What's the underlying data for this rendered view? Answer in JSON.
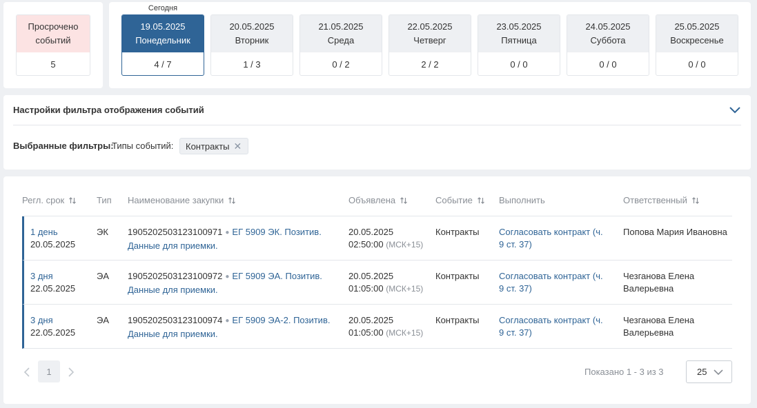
{
  "calendar": {
    "overdue": {
      "line1": "Просрочено",
      "line2": "событий",
      "count": "5"
    },
    "today_label": "Сегодня",
    "days": [
      {
        "date": "19.05.2025",
        "weekday": "Понедельник",
        "count": "4 / 7",
        "selected": true
      },
      {
        "date": "20.05.2025",
        "weekday": "Вторник",
        "count": "1 / 3"
      },
      {
        "date": "21.05.2025",
        "weekday": "Среда",
        "count": "0 / 2"
      },
      {
        "date": "22.05.2025",
        "weekday": "Четверг",
        "count": "2 / 2"
      },
      {
        "date": "23.05.2025",
        "weekday": "Пятница",
        "count": "0 / 0"
      },
      {
        "date": "24.05.2025",
        "weekday": "Суббота",
        "count": "0 / 0"
      },
      {
        "date": "25.05.2025",
        "weekday": "Воскресенье",
        "count": "0 / 0"
      }
    ]
  },
  "filters": {
    "title": "Настройки фильтра отображения событий",
    "selected_label": "Выбранные фильтры:",
    "event_types_label": "Типы событий:",
    "chip": "Контракты",
    "chip_remove": "✕"
  },
  "table": {
    "headers": {
      "deadline": "Регл. срок",
      "type": "Тип",
      "name": "Наименование закупки",
      "announced": "Объявлена",
      "event": "Событие",
      "action": "Выполнить",
      "responsible": "Ответственный"
    },
    "rows": [
      {
        "term": "1 день",
        "date": "20.05.2025",
        "type": "ЭК",
        "number": "1905202503123100971",
        "title_line1": "ЕГ 5909 ЭК. Позитив.",
        "title_line2": "Данные для приемки.",
        "announced_date": "20.05.2025",
        "announced_time": "02:50:00",
        "tz": "(МСК+15)",
        "event": "Контракты",
        "action_line1": "Согласовать контракт (ч.",
        "action_line2": "9 ст. 37)",
        "responsible_line1": "Попова Мария Ивановна",
        "responsible_line2": ""
      },
      {
        "term": "3 дня",
        "date": "22.05.2025",
        "type": "ЭА",
        "number": "1905202503123100972",
        "title_line1": "ЕГ 5909 ЭА. Позитив.",
        "title_line2": "Данные для приемки.",
        "announced_date": "20.05.2025",
        "announced_time": "01:05:00",
        "tz": "(МСК+15)",
        "event": "Контракты",
        "action_line1": "Согласовать контракт (ч.",
        "action_line2": "9 ст. 37)",
        "responsible_line1": "Чезганова Елена",
        "responsible_line2": "Валерьевна"
      },
      {
        "term": "3 дня",
        "date": "22.05.2025",
        "type": "ЭА",
        "number": "1905202503123100974",
        "title_line1": "ЕГ 5909 ЭА-2. Позитив.",
        "title_line2": "Данные для приемки.",
        "announced_date": "20.05.2025",
        "announced_time": "01:05:00",
        "tz": "(МСК+15)",
        "event": "Контракты",
        "action_line1": "Согласовать контракт (ч.",
        "action_line2": "9 ст. 37)",
        "responsible_line1": "Чезганова Елена",
        "responsible_line2": "Валерьевна"
      }
    ]
  },
  "pagination": {
    "current_page": "1",
    "shown": "Показано 1 - 3 из 3",
    "page_size": "25"
  },
  "colors": {
    "accent": "#2f6496",
    "overdue_bg": "#fce3e3",
    "tile_bg": "#eef0f3"
  }
}
